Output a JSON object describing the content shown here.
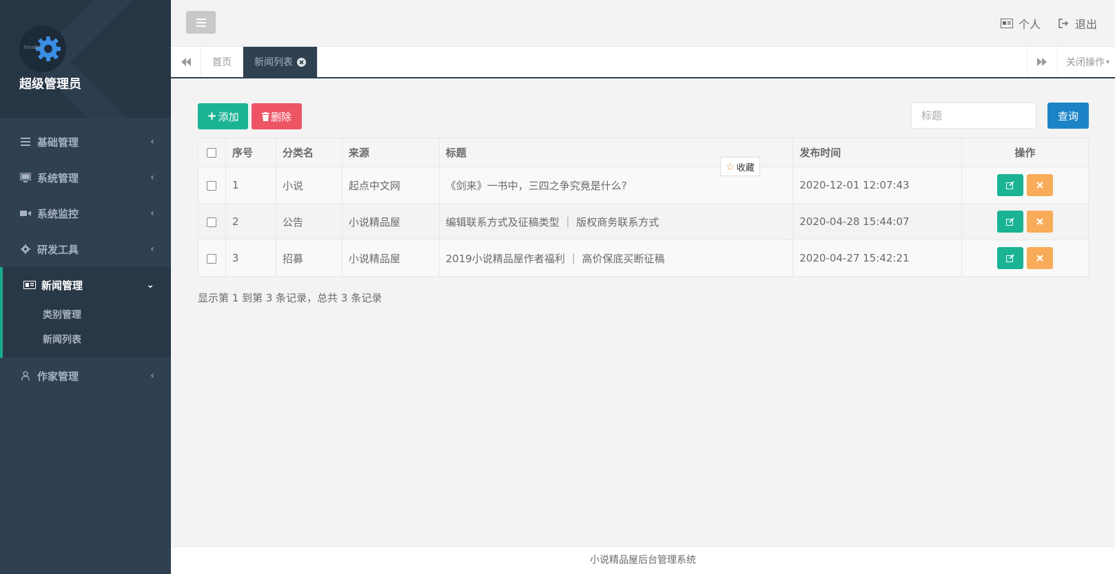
{
  "sidebar": {
    "profile_name": "超级管理员",
    "avatar_text": "SmaBlo",
    "menu": [
      {
        "label": "基础管理",
        "icon": "list-icon"
      },
      {
        "label": "系统管理",
        "icon": "monitor-icon"
      },
      {
        "label": "系统监控",
        "icon": "video-camera-icon"
      },
      {
        "label": "研发工具",
        "icon": "gear-icon"
      }
    ],
    "open_menu": {
      "label": "新闻管理",
      "icon": "newspaper-icon",
      "children": [
        "类别管理",
        "新闻列表"
      ]
    },
    "after_menu": [
      {
        "label": "作家管理",
        "icon": "user-icon"
      }
    ]
  },
  "topbar": {
    "personal_label": "个人",
    "logout_label": "退出"
  },
  "tabs": {
    "items": [
      "首页",
      "新闻列表"
    ],
    "active_index": 1,
    "close_ops_label": "关闭操作"
  },
  "toolbar": {
    "add_label": "添加",
    "delete_label": "删除",
    "search_placeholder": "标题",
    "query_label": "查询"
  },
  "table": {
    "headers": [
      "序号",
      "分类名",
      "来源",
      "标题",
      "发布时间",
      "操作"
    ],
    "rows": [
      {
        "no": "1",
        "category": "小说",
        "source": "起点中文网",
        "title": "《剑来》一书中，三四之争究竟是什么?",
        "time": "2020-12-01 12:07:43"
      },
      {
        "no": "2",
        "category": "公告",
        "source": "小说精品屋",
        "title": "编辑联系方式及征稿类型 ｜ 版权商务联系方式",
        "time": "2020-04-28 15:44:07"
      },
      {
        "no": "3",
        "category": "招募",
        "source": "小说精品屋",
        "title": "2019小说精品屋作者福利 ｜ 高价保底买断征稿",
        "time": "2020-04-27 15:42:21"
      }
    ]
  },
  "pagination_text": "显示第 1 到第 3 条记录，总共 3 条记录",
  "favorite_label": "收藏",
  "footer_text": "小说精品屋后台管理系统",
  "colors": {
    "sidebar": "#2f4050",
    "primary": "#1ab394",
    "danger": "#ed5565",
    "info": "#1c84c6",
    "warning": "#f8ac59"
  }
}
